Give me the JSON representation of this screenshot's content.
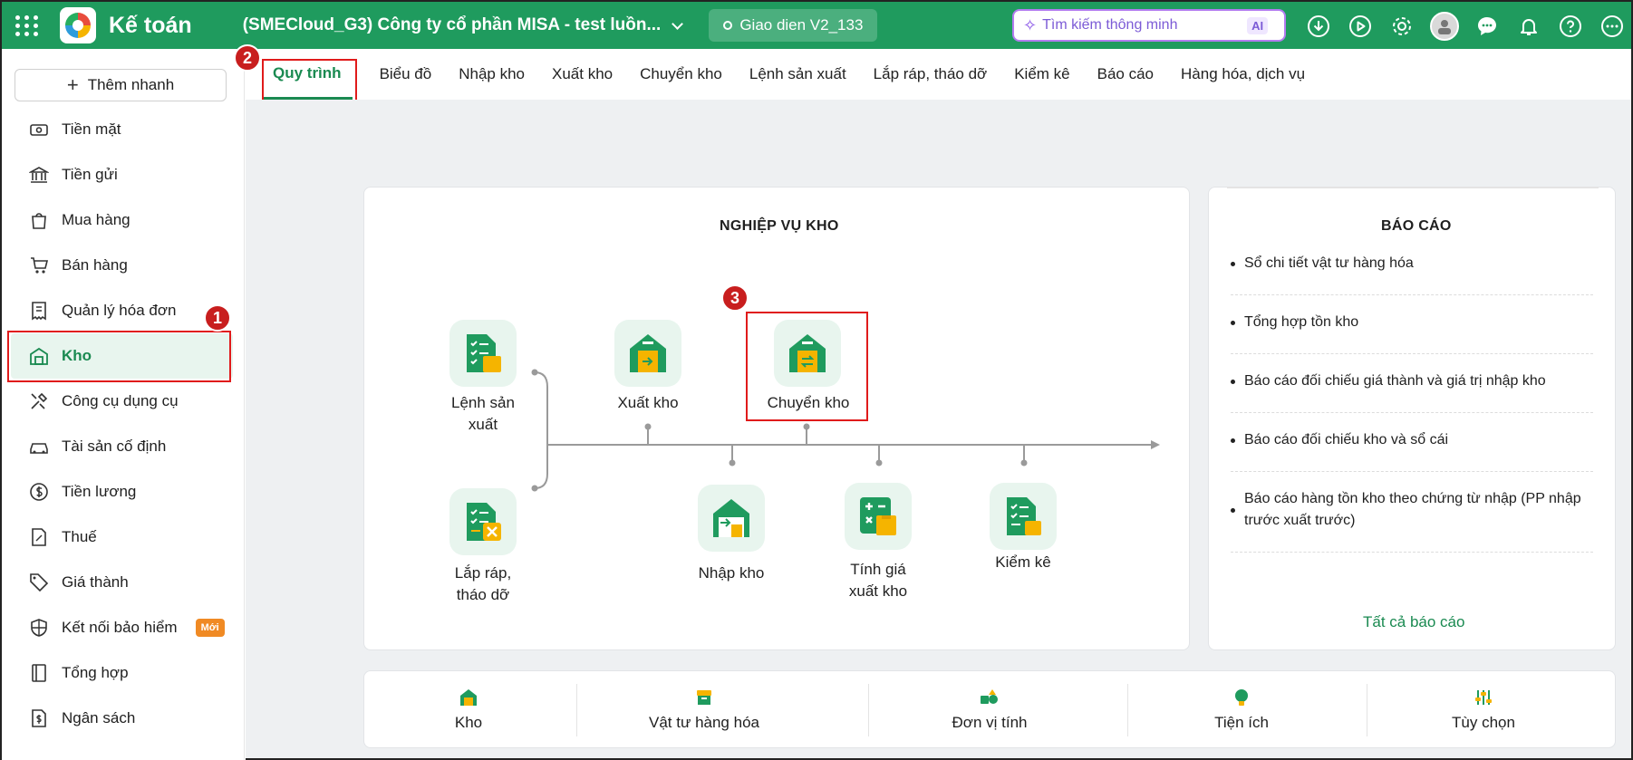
{
  "header": {
    "app_title": "Kế toán",
    "company": "(SMECloud_G3) Công ty cổ phần MISA - test luồn...",
    "version": "Giao dien V2_133",
    "search_placeholder": "Tìm kiếm thông minh",
    "ai_label": "AI"
  },
  "sidebar": {
    "quick_add": "Thêm nhanh",
    "items": [
      {
        "label": "Tiền mặt",
        "icon": "cash-icon"
      },
      {
        "label": "Tiền gửi",
        "icon": "bank-icon"
      },
      {
        "label": "Mua hàng",
        "icon": "shopping-bag-icon"
      },
      {
        "label": "Bán hàng",
        "icon": "cart-icon"
      },
      {
        "label": "Quản lý hóa đơn",
        "icon": "invoice-icon"
      },
      {
        "label": "Kho",
        "icon": "warehouse-icon"
      },
      {
        "label": "Công cụ dụng cụ",
        "icon": "tools-icon"
      },
      {
        "label": "Tài sản cố định",
        "icon": "car-icon"
      },
      {
        "label": "Tiền lương",
        "icon": "dollar-circle-icon"
      },
      {
        "label": "Thuế",
        "icon": "tax-icon"
      },
      {
        "label": "Giá thành",
        "icon": "tag-icon"
      },
      {
        "label": "Kết nối bảo hiểm",
        "icon": "shield-icon",
        "badge": "Mới"
      },
      {
        "label": "Tổng hợp",
        "icon": "book-icon"
      },
      {
        "label": "Ngân sách",
        "icon": "budget-icon"
      }
    ]
  },
  "tabs": [
    "Quy trình",
    "Biểu đồ",
    "Nhập kho",
    "Xuất kho",
    "Chuyển kho",
    "Lệnh sản xuất",
    "Lắp ráp, tháo dỡ",
    "Kiểm kê",
    "Báo cáo",
    "Hàng hóa, dịch vụ"
  ],
  "annotations": [
    "1",
    "2",
    "3"
  ],
  "process": {
    "title": "NGHIỆP VỤ KHO",
    "lenh_san_xuat": "Lệnh sản\nxuất",
    "lap_rap": "Lắp ráp,\ntháo dỡ",
    "xuat_kho": "Xuất kho",
    "chuyen_kho": "Chuyển kho",
    "nhap_kho": "Nhập kho",
    "tinh_gia": "Tính giá\nxuất kho",
    "kiem_ke": "Kiểm kê"
  },
  "reports": {
    "title": "BÁO CÁO",
    "items": [
      "Sổ chi tiết vật tư hàng hóa",
      "Tổng hợp tồn kho",
      "Báo cáo đối chiếu giá thành và giá trị nhập kho",
      "Báo cáo đối chiếu kho và sổ cái",
      "Báo cáo hàng tồn kho theo chứng từ nhập (PP nhập trước xuất trước)"
    ],
    "all_link": "Tất cả báo cáo"
  },
  "bottom_bar": [
    "Kho",
    "Vật tư hàng hóa",
    "Đơn vị tính",
    "Tiện ích",
    "Tùy chọn"
  ],
  "colors": {
    "brand": "#1f9b5e",
    "accent": "#1a8a51",
    "annotation": "#c81e1e",
    "icon_yellow": "#f5b400"
  }
}
